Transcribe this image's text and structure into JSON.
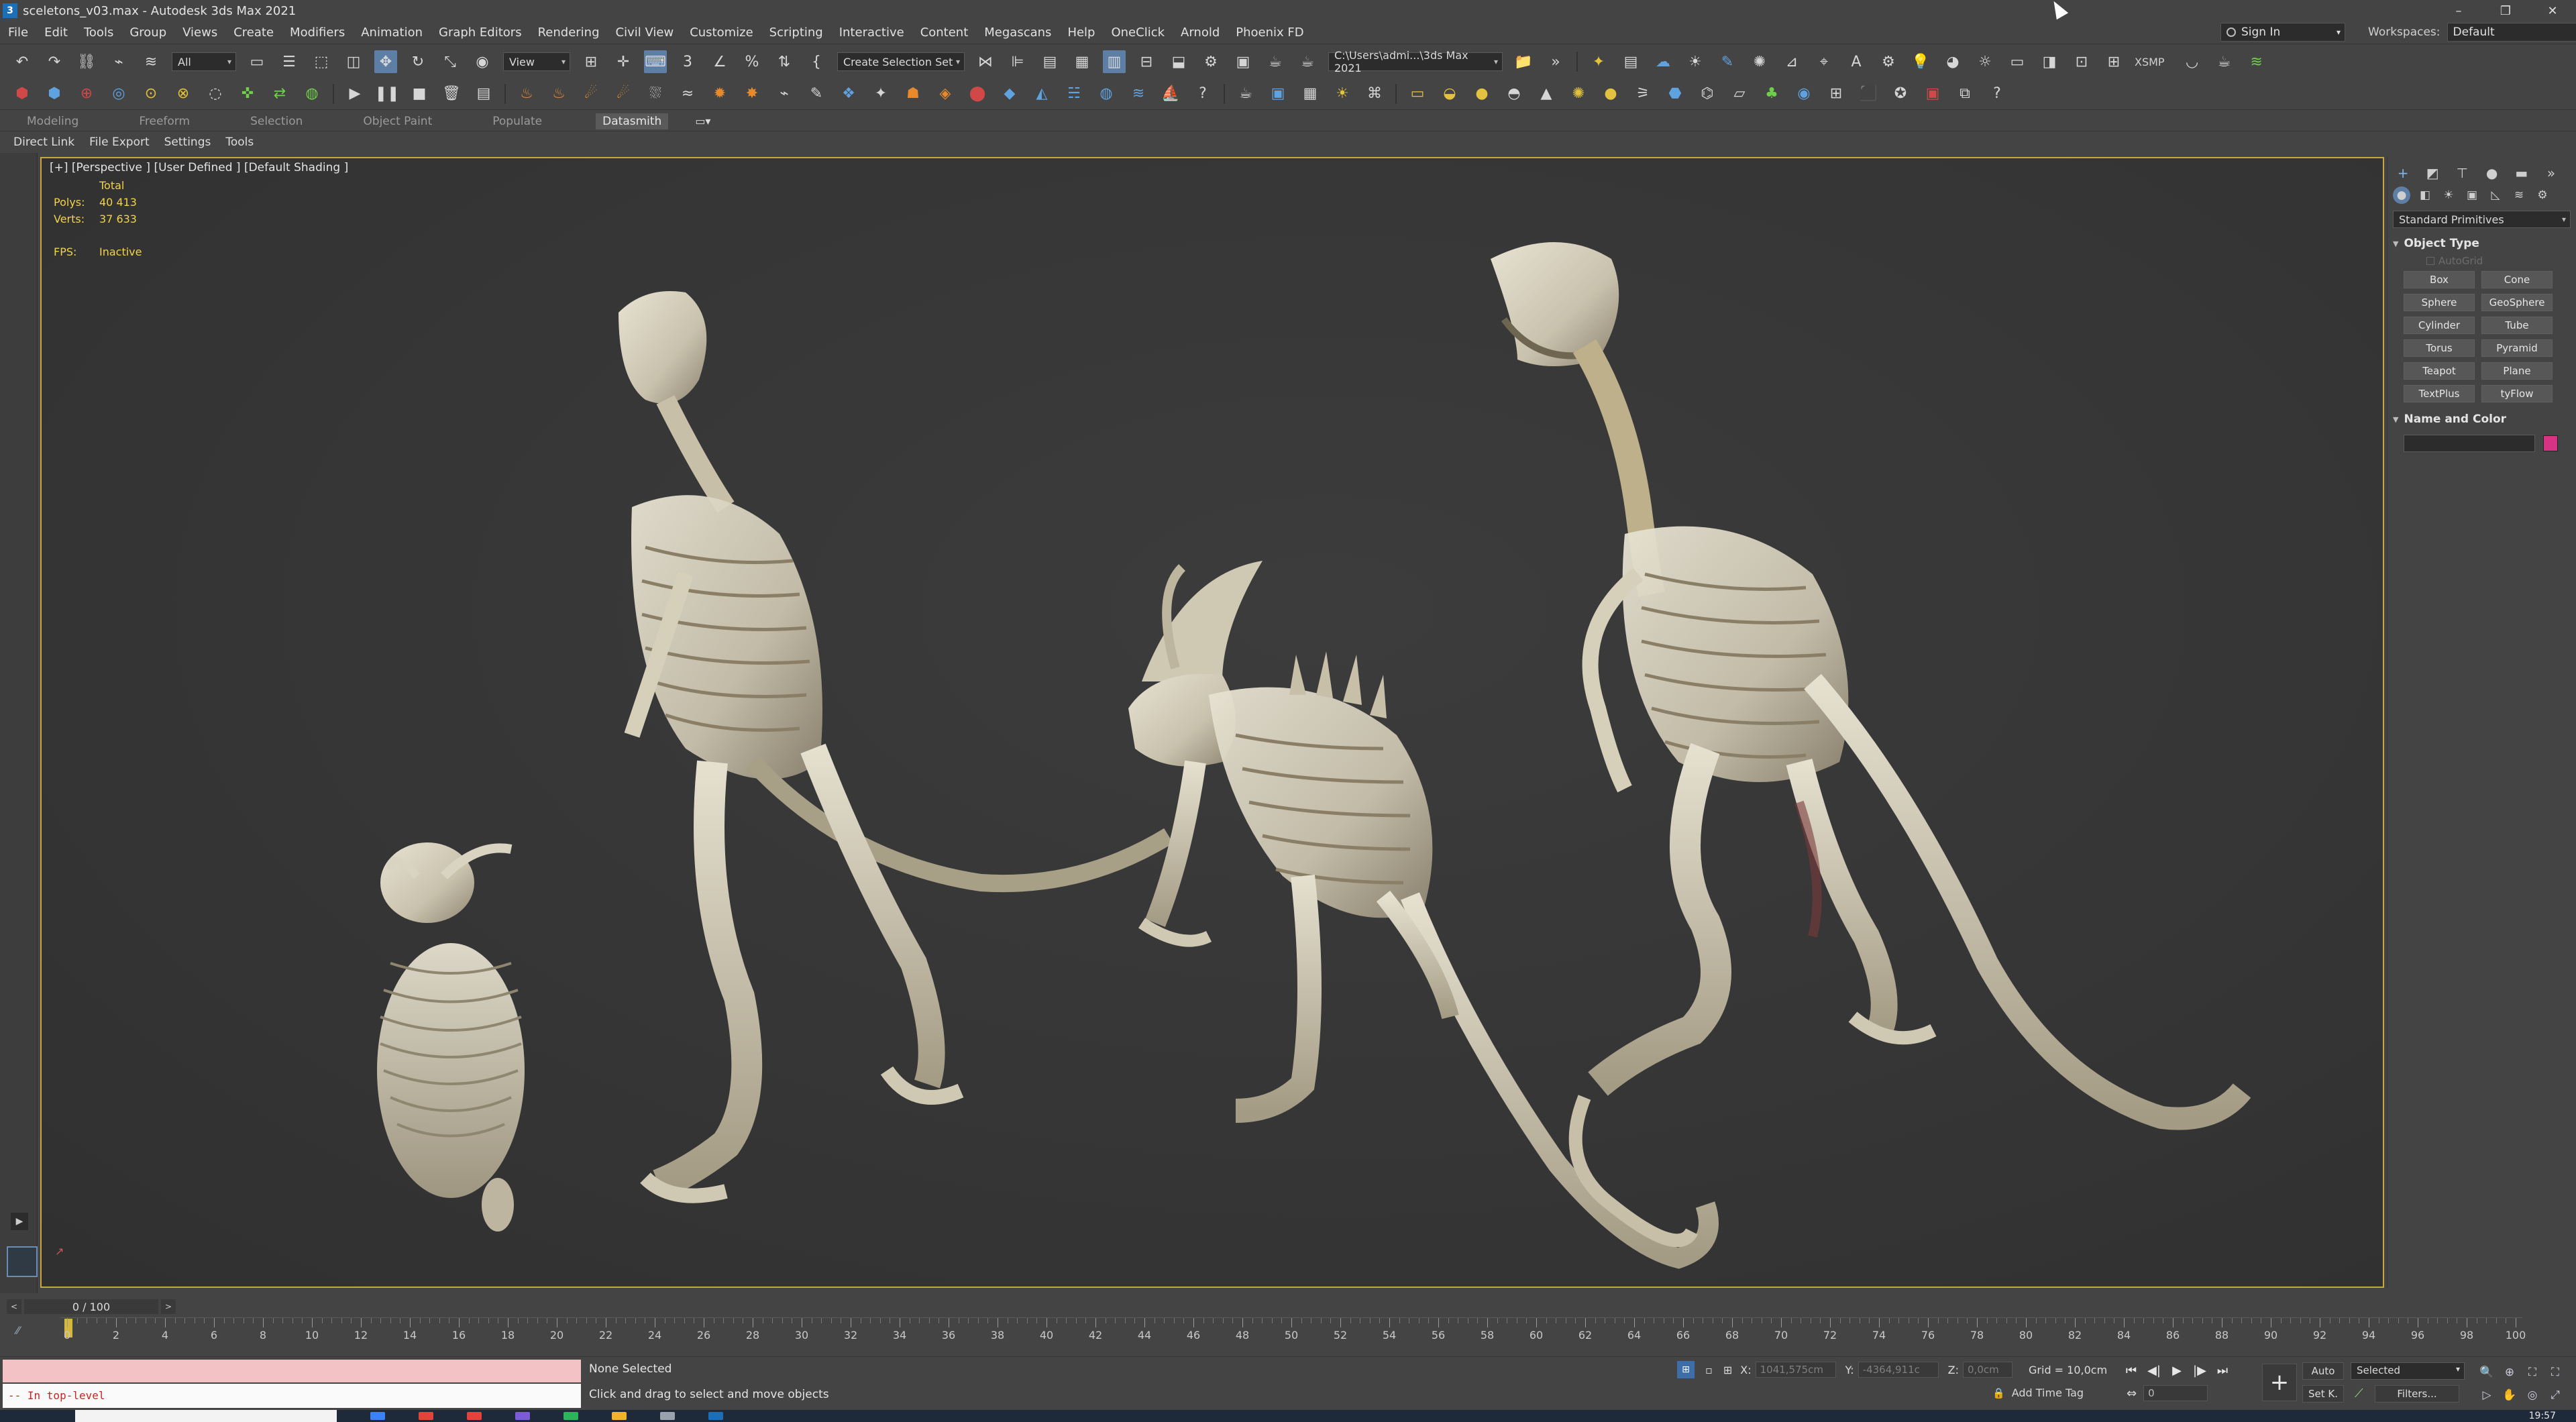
{
  "window": {
    "title": "sceletons_v03.max - Autodesk 3ds Max 2021",
    "controls": [
      "–",
      "❐",
      "✕"
    ]
  },
  "menu": [
    "File",
    "Edit",
    "Tools",
    "Group",
    "Views",
    "Create",
    "Modifiers",
    "Animation",
    "Graph Editors",
    "Rendering",
    "Civil View",
    "Customize",
    "Scripting",
    "Interactive",
    "Content",
    "Megascans",
    "Help",
    "OneClick",
    "Arnold",
    "Phoenix FD"
  ],
  "account": {
    "signin_label": "Sign In",
    "workspace_label": "Workspaces:",
    "workspace_value": "Default"
  },
  "toolbar": {
    "selection_filter": "All",
    "ref_coord": "View",
    "selection_set": "Create Selection Set",
    "project_path": "C:\\Users\\admi...\\3ds Max 2021",
    "xsmp_label": "XSMP"
  },
  "ribbon": {
    "tabs": [
      "Modeling",
      "Freeform",
      "Selection",
      "Object Paint",
      "Populate",
      "Datasmith"
    ],
    "active_tab": "Datasmith",
    "subtabs": [
      "Direct Link",
      "File Export",
      "Settings",
      "Tools"
    ]
  },
  "viewport": {
    "label": "[+] [Perspective ] [User Defined ] [Default Shading ]",
    "stats": {
      "header": "Total",
      "polys_label": "Polys:",
      "polys_value": "40 413",
      "verts_label": "Verts:",
      "verts_value": "37 633",
      "fps_label": "FPS:",
      "fps_value": "Inactive"
    }
  },
  "command_panel": {
    "category": "Standard Primitives",
    "object_type_header": "Object Type",
    "autogrid_label": "AutoGrid",
    "primitives": [
      "Box",
      "Cone",
      "Sphere",
      "GeoSphere",
      "Cylinder",
      "Tube",
      "Torus",
      "Pyramid",
      "Teapot",
      "Plane",
      "TextPlus",
      "tyFlow"
    ],
    "name_color_header": "Name and Color",
    "object_color": "#d63384"
  },
  "timeline": {
    "frame_display": "0 / 100",
    "ticks": [
      "0",
      "2",
      "4",
      "6",
      "8",
      "10",
      "12",
      "14",
      "16",
      "18",
      "20",
      "22",
      "24",
      "26",
      "28",
      "30",
      "32",
      "34",
      "36",
      "38",
      "40",
      "42",
      "44",
      "46",
      "48",
      "50",
      "52",
      "54",
      "56",
      "58",
      "60",
      "62",
      "64",
      "66",
      "68",
      "70",
      "72",
      "74",
      "76",
      "78",
      "80",
      "82",
      "84",
      "86",
      "88",
      "90",
      "92",
      "94",
      "96",
      "98",
      "100"
    ]
  },
  "status": {
    "maxscript_output": "-- In top-level",
    "selection": "None Selected",
    "prompt": "Click and drag to select and move objects",
    "x_label": "X:",
    "x_value": "1041,575cm",
    "y_label": "Y:",
    "y_value": "-4364,911c",
    "z_label": "Z:",
    "z_value": "0,0cm",
    "grid": "Grid = 10,0cm",
    "add_time_tag": "Add Time Tag",
    "current_frame": "0",
    "auto_label": "Auto",
    "setk_label": "Set K.",
    "key_filter": "Selected",
    "filters_label": "Filters..."
  },
  "taskbar": {
    "clock": "19:57"
  }
}
